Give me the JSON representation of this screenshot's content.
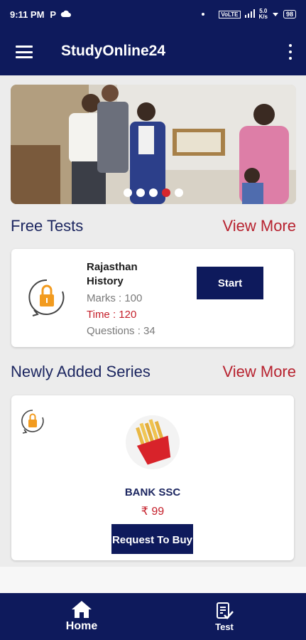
{
  "status_bar": {
    "time": "9:11 PM",
    "parking_glyph": "P",
    "network_speed_top": "5.0",
    "network_speed_bottom": "K/s",
    "network_label": "VoLTE",
    "battery": "98"
  },
  "app_bar": {
    "title": "StudyOnline24"
  },
  "banner": {
    "slide_count": 5,
    "active_slide": 4
  },
  "free_tests": {
    "heading": "Free Tests",
    "view_more": "View More",
    "test": {
      "title": "Rajasthan History",
      "marks": "Marks : 100",
      "time": "Time : 120",
      "questions": "Questions : 34",
      "start_label": "Start"
    }
  },
  "newly_added": {
    "heading": "Newly Added Series",
    "view_more": "View More",
    "series": {
      "name": "BANK SSC",
      "price": "₹ 99",
      "request_label": "Request To Buy"
    }
  },
  "bottom_nav": {
    "home_label": "Home",
    "test_label": "Test"
  },
  "colors": {
    "primary": "#0e1a5c",
    "accent_red": "#c5202b",
    "lock_orange": "#f29b1f"
  }
}
